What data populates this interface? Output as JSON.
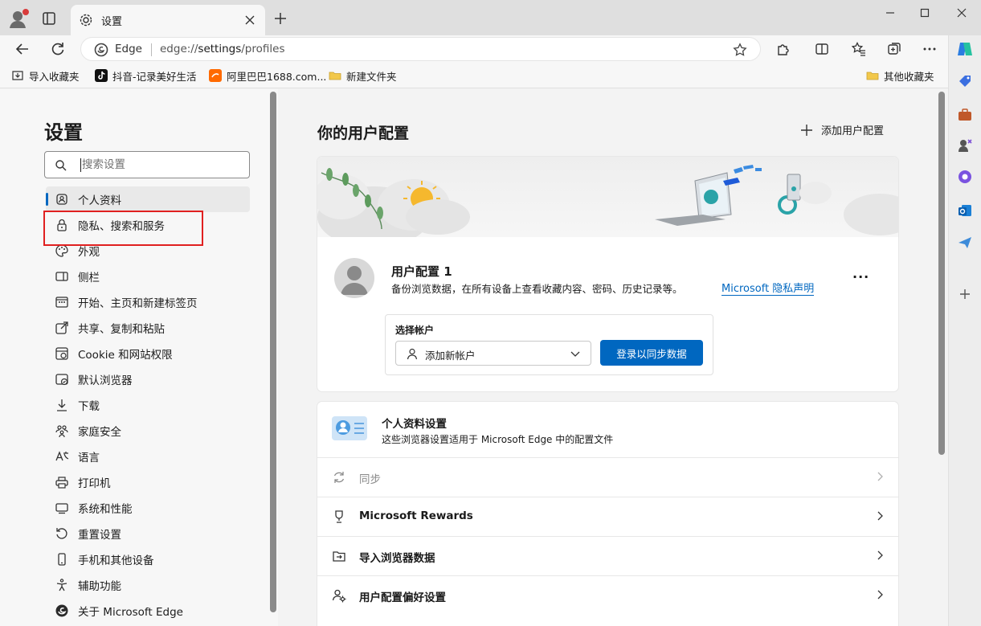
{
  "browser": {
    "tab": {
      "title": "设置"
    },
    "address": {
      "site_label": "Edge",
      "url_prefix": "edge://",
      "url_host": "settings",
      "url_path": "/profiles"
    }
  },
  "bookmarks": [
    {
      "label": "导入收藏夹",
      "icon": "import-favorites-icon"
    },
    {
      "label": "抖音-记录美好生活",
      "icon": "douyin-icon"
    },
    {
      "label": "阿里巴巴1688.com...",
      "icon": "alibaba-icon"
    },
    {
      "label": "新建文件夹",
      "icon": "folder-icon"
    },
    {
      "label": "其他收藏夹",
      "icon": "folder-icon"
    }
  ],
  "nav": {
    "title": "设置",
    "search_placeholder": "搜索设置",
    "items": [
      {
        "label": "个人资料",
        "icon": "profile-icon",
        "active": true
      },
      {
        "label": "隐私、搜索和服务",
        "icon": "lock-icon"
      },
      {
        "label": "外观",
        "icon": "palette-icon"
      },
      {
        "label": "侧栏",
        "icon": "sidebar-icon"
      },
      {
        "label": "开始、主页和新建标签页",
        "icon": "home-tabs-icon"
      },
      {
        "label": "共享、复制和粘贴",
        "icon": "share-icon"
      },
      {
        "label": "Cookie 和网站权限",
        "icon": "cookie-icon"
      },
      {
        "label": "默认浏览器",
        "icon": "default-browser-icon"
      },
      {
        "label": "下载",
        "icon": "download-icon"
      },
      {
        "label": "家庭安全",
        "icon": "family-icon"
      },
      {
        "label": "语言",
        "icon": "language-icon"
      },
      {
        "label": "打印机",
        "icon": "printer-icon"
      },
      {
        "label": "系统和性能",
        "icon": "system-icon"
      },
      {
        "label": "重置设置",
        "icon": "reset-icon"
      },
      {
        "label": "手机和其他设备",
        "icon": "phone-icon"
      },
      {
        "label": "辅助功能",
        "icon": "accessibility-icon"
      },
      {
        "label": "关于 Microsoft Edge",
        "icon": "edge-logo-icon"
      }
    ]
  },
  "main": {
    "title": "你的用户配置",
    "add_profile_label": "添加用户配置",
    "profile": {
      "name": "用户配置 1",
      "description": "备份浏览数据，在所有设备上查看收藏内容、密码、历史记录等。",
      "privacy_link": "Microsoft 隐私声明",
      "more": "···",
      "account_label": "选择帐户",
      "account_select": "添加新帐户",
      "signin_button": "登录以同步数据"
    },
    "profile_settings": {
      "title": "个人资料设置",
      "description": "这些浏览器设置适用于 Microsoft Edge 中的配置文件",
      "rows": [
        {
          "label": "同步",
          "icon": "sync-icon",
          "disabled": true
        },
        {
          "label": "Microsoft Rewards",
          "icon": "trophy-icon"
        },
        {
          "label": "导入浏览器数据",
          "icon": "import-icon"
        },
        {
          "label": "用户配置偏好设置",
          "icon": "profile-prefs-icon"
        }
      ]
    }
  },
  "colors": {
    "accent": "#0067c0",
    "highlight_box": "#e02020"
  }
}
